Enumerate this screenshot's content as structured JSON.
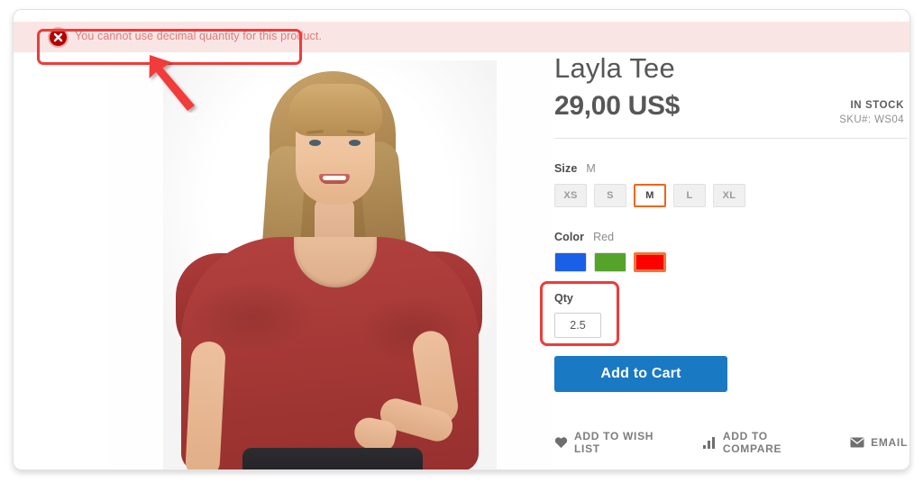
{
  "message_banner": {
    "icon": "error-circle-x-icon",
    "text": "You cannot use decimal quantity for this product.",
    "background_color": "#fae5e5",
    "text_color": "#e07a7a",
    "icon_color": "#b30000"
  },
  "annotations": {
    "highlight_color": "#ef3b3b",
    "arrow": "red-arrow-pointing-up-left",
    "boxes": [
      "error-message-banner",
      "qty-field"
    ]
  },
  "gallery": {
    "alt": "Layla Tee product photo - model wearing red tee"
  },
  "product": {
    "title": "Layla Tee",
    "price": "29,00 US$",
    "stock_status": "IN STOCK",
    "sku_label": "SKU#:",
    "sku_value": "WS04"
  },
  "options": {
    "size": {
      "label": "Size",
      "selected": "M",
      "values": [
        {
          "label": "XS",
          "selected": false
        },
        {
          "label": "S",
          "selected": false
        },
        {
          "label": "M",
          "selected": true
        },
        {
          "label": "L",
          "selected": false
        },
        {
          "label": "XL",
          "selected": false
        }
      ]
    },
    "color": {
      "label": "Color",
      "selected": "Red",
      "values": [
        {
          "name": "Blue",
          "hex": "#1a5fe8",
          "selected": false
        },
        {
          "name": "Green",
          "hex": "#55a32b",
          "selected": false
        },
        {
          "name": "Red",
          "hex": "#ff0000",
          "selected": true
        }
      ]
    }
  },
  "qty": {
    "label": "Qty",
    "value": "2.5",
    "placeholder": ""
  },
  "actions": {
    "add_to_cart": "Add to Cart",
    "add_to_cart_color": "#1979c3"
  },
  "product_links": [
    {
      "icon": "heart-icon",
      "label": "ADD TO WISH LIST"
    },
    {
      "icon": "compare-bars-icon",
      "label": "ADD TO COMPARE"
    },
    {
      "icon": "envelope-icon",
      "label": "EMAIL"
    }
  ]
}
